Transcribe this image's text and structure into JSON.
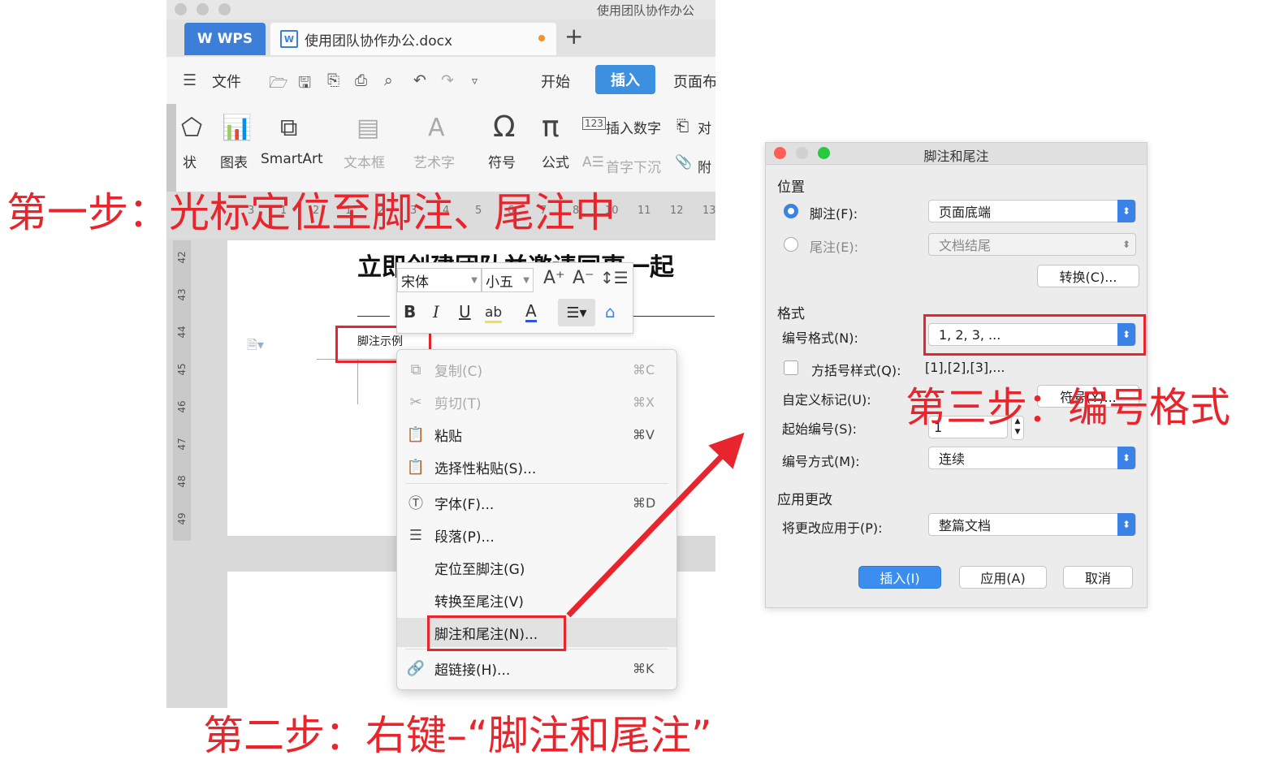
{
  "window": {
    "title": "使用团队协作办公",
    "app_tab": "WPS",
    "doc_tab": "使用团队协作办公.docx",
    "new_tab": "+"
  },
  "menubar": {
    "file": "文件",
    "tabs": [
      "开始",
      "插入",
      "页面布"
    ]
  },
  "ribbon": {
    "items": [
      "状",
      "图表",
      "SmartArt",
      "文本框",
      "艺术字",
      "符号",
      "公式"
    ],
    "insert_number": "插入数字",
    "object": "对",
    "dropcap": "首字下沉",
    "attach": "附"
  },
  "ruler": {
    "numbers": [
      "3",
      "1",
      "2",
      "1",
      "2",
      "3",
      "4",
      "5",
      "6",
      "7",
      "8",
      "10",
      "11",
      "12",
      "13",
      "1"
    ],
    "vertical": [
      "42",
      "43",
      "44",
      "45",
      "46",
      "47",
      "48",
      "49"
    ]
  },
  "document": {
    "heading": "立即创建团队并邀请同事一起",
    "footnote_text": "脚注示例"
  },
  "mini_toolbar": {
    "font": "宋体",
    "size": "小五",
    "bold": "B",
    "italic": "I",
    "underline": "U",
    "highlight": "ab",
    "color": "A"
  },
  "context_menu": {
    "items": [
      {
        "label": "复制(C)",
        "shortcut": "⌘C",
        "icon": "copy-icon",
        "glyph": "⧉",
        "enabled": false
      },
      {
        "label": "剪切(T)",
        "shortcut": "⌘X",
        "icon": "scissors-icon",
        "glyph": "✂",
        "enabled": false
      },
      {
        "label": "粘贴",
        "shortcut": "⌘V",
        "icon": "paste-icon",
        "glyph": "📋",
        "enabled": true
      },
      {
        "label": "选择性粘贴(S)...",
        "shortcut": "",
        "icon": "paste-special-icon",
        "glyph": "📋",
        "enabled": true
      },
      {
        "label": "字体(F)...",
        "shortcut": "⌘D",
        "icon": "font-icon",
        "glyph": "Ⓣ",
        "enabled": true
      },
      {
        "label": "段落(P)...",
        "shortcut": "",
        "icon": "paragraph-icon",
        "glyph": "☰",
        "enabled": true
      },
      {
        "label": "定位至脚注(G)",
        "shortcut": "",
        "icon": "",
        "glyph": "",
        "enabled": true
      },
      {
        "label": "转换至尾注(V)",
        "shortcut": "",
        "icon": "",
        "glyph": "",
        "enabled": true
      },
      {
        "label": "脚注和尾注(N)...",
        "shortcut": "",
        "icon": "",
        "glyph": "",
        "enabled": true,
        "highlighted": true
      },
      {
        "label": "超链接(H)...",
        "shortcut": "⌘K",
        "icon": "link-icon",
        "glyph": "🔗",
        "enabled": true
      }
    ]
  },
  "dialog": {
    "title": "脚注和尾注",
    "position_section": "位置",
    "footnote_label": "脚注(F):",
    "footnote_value": "页面底端",
    "endnote_label": "尾注(E):",
    "endnote_value": "文档结尾",
    "convert_button": "转换(C)...",
    "format_section": "格式",
    "number_format_label": "编号格式(N):",
    "number_format_value": "1, 2, 3, ...",
    "bracket_label": "方括号样式(Q):",
    "bracket_value": "[1],[2],[3],...",
    "custom_mark_label": "自定义标记(U):",
    "symbol_button": "符号(Y)...",
    "start_label": "起始编号(S):",
    "start_value": "1",
    "numbering_label": "编号方式(M):",
    "numbering_value": "连续",
    "apply_section": "应用更改",
    "apply_to_label": "将更改应用于(P):",
    "apply_to_value": "整篇文档",
    "insert_button": "插入(I)",
    "apply_button": "应用(A)",
    "cancel_button": "取消"
  },
  "annotations": {
    "step1": "第一步：光标定位至脚注、尾注中",
    "step2": "第二步：右键–“脚注和尾注”",
    "step3": "第三步：编号格式",
    "color": "#e8252c"
  }
}
